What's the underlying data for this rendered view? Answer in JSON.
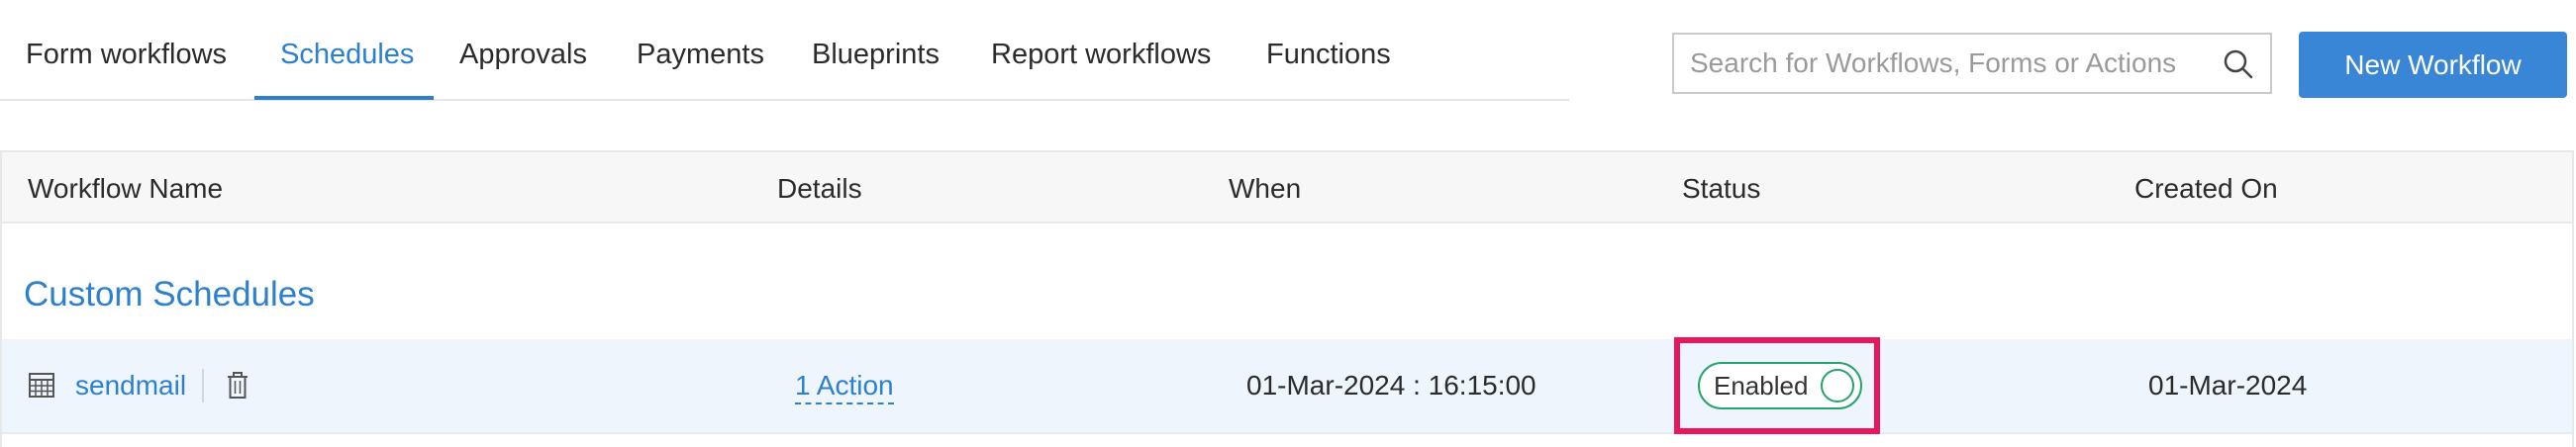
{
  "tabs": [
    {
      "label": "Form workflows"
    },
    {
      "label": "Schedules"
    },
    {
      "label": "Approvals"
    },
    {
      "label": "Payments"
    },
    {
      "label": "Blueprints"
    },
    {
      "label": "Report workflows"
    },
    {
      "label": "Functions"
    }
  ],
  "active_tab": "Schedules",
  "search": {
    "placeholder": "Search for Workflows, Forms or Actions",
    "value": ""
  },
  "new_workflow_label": "New Workflow",
  "table": {
    "headers": [
      "Workflow Name",
      "Details",
      "When",
      "Status",
      "Created On"
    ],
    "group_title": "Custom Schedules",
    "rows": [
      {
        "name": "sendmail",
        "details": "1 Action",
        "when": "01-Mar-2024 : 16:15:00",
        "status": "Enabled",
        "created_on": "01-Mar-2024"
      }
    ]
  },
  "colors": {
    "accent": "#2d7fcf",
    "button": "#3a86d6",
    "status_green": "#27a36b",
    "highlight": "#e8175d",
    "row_highlight": "#eef5fc"
  },
  "icons": {
    "search": "search-icon",
    "schedule": "calendar-icon",
    "delete": "trash-icon",
    "status_toggle": "toggle-knob-icon"
  }
}
